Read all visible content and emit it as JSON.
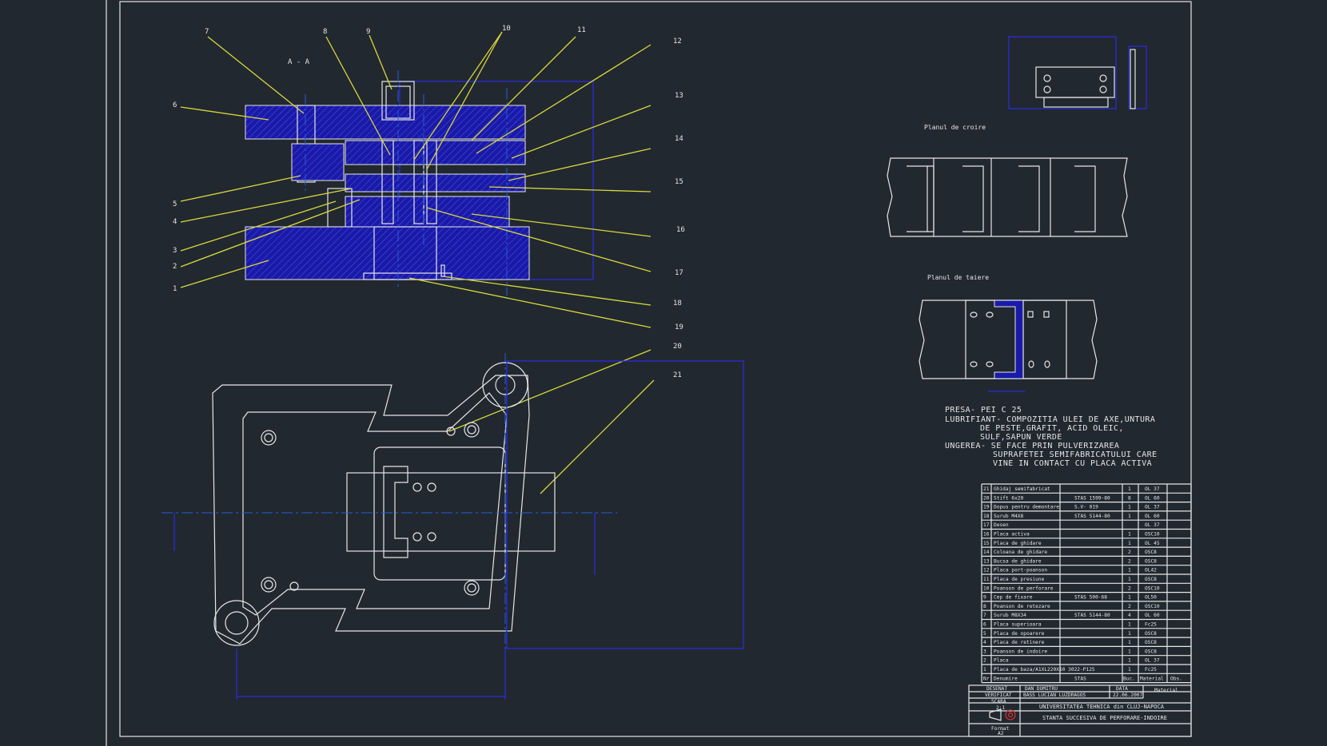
{
  "section_label": "A - A",
  "callouts": [
    "7",
    "8",
    "9",
    "10",
    "11",
    "12",
    "13",
    "14",
    "15",
    "16",
    "17",
    "18",
    "19",
    "20",
    "21",
    "6",
    "5",
    "4",
    "3",
    "2",
    "1"
  ],
  "view_titles": {
    "cutting_plan": "Planul de croire",
    "pressing_plan": "Planul de taiere"
  },
  "notes": [
    "PRESA- PEI C 25",
    "LUBRIFIANT- COMPOZITIA ULEI DE AXE,UNTURA",
    "DE PESTE,GRAFIT, ACID OLEIC,",
    "SULF,SAPUN VERDE",
    "UNGEREA- SE FACE PRIN PULVERIZAREA",
    "SUPRAFETEI SEMIFABRICATULUI CARE",
    "VINE IN CONTACT CU PLACA ACTIVA"
  ],
  "bom": [
    {
      "no": "21",
      "name": "Ghidaj semifabricat",
      "std": "",
      "qty": "1",
      "mat": "OL 37"
    },
    {
      "no": "20",
      "name": "Stift 6x20",
      "std": "STAS 1599-80",
      "qty": "8",
      "mat": "OL 60"
    },
    {
      "no": "19",
      "name": "Dopus pentru demontare",
      "std": "S.V- 019",
      "qty": "1",
      "mat": "OL 37"
    },
    {
      "no": "18",
      "name": "Surub M4X8",
      "std": "STAS 5144-80",
      "qty": "1",
      "mat": "OL 60"
    },
    {
      "no": "17",
      "name": "Desen",
      "std": "",
      "qty": "",
      "mat": "OL 37"
    },
    {
      "no": "16",
      "name": "Placa activa",
      "std": "",
      "qty": "1",
      "mat": "OSC10"
    },
    {
      "no": "15",
      "name": "Placa de ghidare",
      "std": "",
      "qty": "1",
      "mat": "OL 45"
    },
    {
      "no": "14",
      "name": "Coloana de ghidare",
      "std": "",
      "qty": "2",
      "mat": "OSC8"
    },
    {
      "no": "13",
      "name": "Bucsa de ghidare",
      "std": "",
      "qty": "2",
      "mat": "OSC8"
    },
    {
      "no": "12",
      "name": "Placa port-poanson",
      "std": "",
      "qty": "1",
      "mat": "OL42"
    },
    {
      "no": "11",
      "name": "Placa de presiune",
      "std": "",
      "qty": "1",
      "mat": "OSC8"
    },
    {
      "no": "10",
      "name": "Poanson de perforare",
      "std": "",
      "qty": "2",
      "mat": "OSC10"
    },
    {
      "no": "9",
      "name": "Cep de fixare",
      "std": "STAS 500-68",
      "qty": "1",
      "mat": "OL50"
    },
    {
      "no": "8",
      "name": "Poanson de retezare",
      "std": "",
      "qty": "2",
      "mat": "OSC10"
    },
    {
      "no": "7",
      "name": "Surub M8X34",
      "std": "STAS 5144-80",
      "qty": "4",
      "mat": "OL 60"
    },
    {
      "no": "6",
      "name": "Placa superioara",
      "std": "",
      "qty": "1",
      "mat": "Fc25"
    },
    {
      "no": "5",
      "name": "Placa de opoarere",
      "std": "",
      "qty": "1",
      "mat": "OSC8"
    },
    {
      "no": "4",
      "name": "Placa de retinere",
      "std": "",
      "qty": "1",
      "mat": "OSC8"
    },
    {
      "no": "3",
      "name": "Poanson de indoire",
      "std": "",
      "qty": "1",
      "mat": "OSC8"
    },
    {
      "no": "2",
      "name": "Placa",
      "std": "",
      "qty": "1",
      "mat": "OL 37"
    },
    {
      "no": "1",
      "name": "Placa de baza/A1XL220X10 3022-P125",
      "std": "",
      "qty": "1",
      "mat": "Fc25"
    }
  ],
  "bom_header": {
    "no": "Nr",
    "name": "Denumire",
    "std": "STAS",
    "qty": "Buc.",
    "mat": "Material",
    "obs": "Obs."
  },
  "title_block": {
    "drawn_label": "DESENAT",
    "drawn_name": "DAN DUMITRU",
    "checked_label": "VERIFICAT",
    "checked_name": "BASS LUCIAN LUZDRAGOS",
    "scale_label": "SCARA",
    "scale_value": "2:1",
    "date_label": "DATA",
    "date_value": "22.06.2007",
    "material_label": "Material",
    "university": "UNIVERSITATEA TEHNICA din CLUJ-NAPOCA",
    "title": "STANTA SUCCESIVA DE PERFORARE-INDOIRE",
    "format_label": "Format",
    "format_value": "A2"
  }
}
